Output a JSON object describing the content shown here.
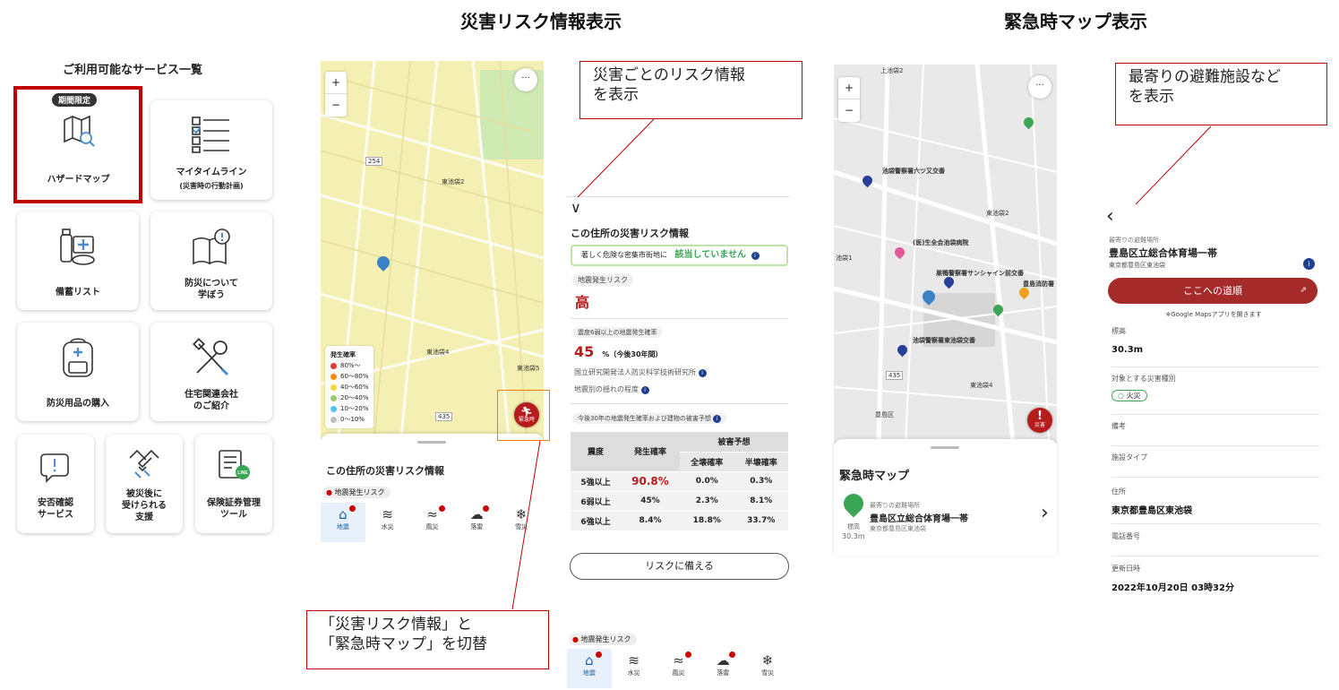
{
  "titles": {
    "left": "災害リスク情報表示",
    "right": "緊急時マップ表示"
  },
  "service_list": {
    "heading": "ご利用可能なサービス一覧",
    "badge": "期間限定",
    "items": [
      {
        "label": "ハザードマップ",
        "icon": "map-search-icon"
      },
      {
        "label": "マイタイムライン",
        "sub": "(災害時の行動計画)",
        "icon": "checklist-icon"
      },
      {
        "label": "備蓄リスト",
        "icon": "supplies-icon"
      },
      {
        "label": "防災について\n学ぼう",
        "icon": "book-alert-icon"
      },
      {
        "label": "防災用品の購入",
        "icon": "backpack-icon"
      },
      {
        "label": "住宅関連会社\nのご紹介",
        "icon": "tools-icon"
      },
      {
        "label": "安否確認\nサービス",
        "icon": "message-alert-icon"
      },
      {
        "label": "被災後に\n受けられる\n支援",
        "icon": "handshake-icon"
      },
      {
        "label": "保険証券管理\nツール",
        "icon": "document-line-icon"
      }
    ]
  },
  "hazard_map": {
    "zoom_in": "+",
    "zoom_out": "−",
    "more": "···",
    "labels": {
      "higashi_ikebukuro2": "東池袋2",
      "higashi_ikebukuro4": "東池袋4",
      "higashi_ikebukuro5": "東池袋5",
      "road_254": "254",
      "road_435": "435"
    },
    "legend": {
      "title": "発生確率",
      "items": [
        {
          "label": "80%〜",
          "color": "#e53935"
        },
        {
          "label": "60〜80%",
          "color": "#fb8c00"
        },
        {
          "label": "40〜60%",
          "color": "#fdd835"
        },
        {
          "label": "20〜40%",
          "color": "#9ccc65"
        },
        {
          "label": "10〜20%",
          "color": "#4fc3f7"
        },
        {
          "label": "0〜10%",
          "color": "#bdbdbd"
        }
      ]
    },
    "emergency_button": "緊急時",
    "sheet_title": "この住所の災害リスク情報",
    "risk_chip": "地震発生リスク"
  },
  "tabs": [
    {
      "label": "地震",
      "icon": "house-earthquake-icon",
      "alert": true
    },
    {
      "label": "水災",
      "icon": "water-wave-icon",
      "alert": false
    },
    {
      "label": "風災",
      "icon": "wind-icon",
      "alert": true
    },
    {
      "label": "落雷",
      "icon": "cloud-lightning-icon",
      "alert": true
    },
    {
      "label": "雪災",
      "icon": "snowflake-icon",
      "alert": false
    }
  ],
  "risk_detail": {
    "collapse": "∨",
    "title": "この住所の災害リスク情報",
    "dense_area_label": "著しく危険な密集市街地に",
    "dense_area_value": "該当していません",
    "eq_risk_chip": "地震発生リスク",
    "eq_risk_value": "高",
    "prob_chip": "震度6弱以上の地震発生確率",
    "prob_value": "45",
    "prob_unit": "%（今後30年間）",
    "source": "国立研究開発法人防災科学技術研究所",
    "shake_link": "地震別の揺れの程度",
    "forecast_chip": "今後30年の地震発生確率および建物の被害予想",
    "table": {
      "h_intensity": "震度",
      "h_prob": "発生確率",
      "h_damage": "被害予想",
      "h_full": "全壊確率",
      "h_half": "半壊確率",
      "rows": [
        {
          "intensity": "5強以上",
          "prob": "90.8%",
          "full": "0.0%",
          "half": "0.3%"
        },
        {
          "intensity": "6弱以上",
          "prob": "45%",
          "full": "2.3%",
          "half": "8.1%"
        },
        {
          "intensity": "6強以上",
          "prob": "8.4%",
          "full": "18.8%",
          "half": "33.7%"
        }
      ]
    },
    "prepare_button": "リスクに備える",
    "bottom_chip": "地震発生リスク"
  },
  "notes": {
    "risk_info": "災害ごとのリスク情報\nを表示",
    "switch": "「災害リスク情報」と\n「緊急時マップ」を切替",
    "nearest": "最寄りの避難施設など\nを表示"
  },
  "emergency_map": {
    "zoom_in": "+",
    "zoom_out": "−",
    "more": "···",
    "labels": {
      "kami_ikebukuro2": "上池袋2",
      "police_rokutsu": "池袋警察署六ツ又交番",
      "higashi_ikebukuro2": "東池袋2",
      "hospital": "(医)生全会池袋病院",
      "sunshine": "巣鴨警察署サンシャイン前交番",
      "toshima_fire": "豊島消防署",
      "ikebukuro1": "池袋1",
      "higashi_police": "池袋警察署東池袋交番",
      "higashi_ikebukuro4": "東池袋4",
      "toshima_ku": "豊島区",
      "road_435": "435"
    },
    "disaster_button": "災害",
    "sheet_title": "緊急時マップ",
    "shelter_kind": "最寄りの避難場所",
    "shelter_name": "豊島区立総合体育場一帯",
    "shelter_address": "東京都豊島区東池袋",
    "elevation_label": "標高",
    "elevation_value": "30.3m",
    "chevron": "›"
  },
  "facility_detail": {
    "back": "‹",
    "kind": "最寄りの避難場所",
    "name": "豊島区立総合体育場一帯",
    "address": "東京都豊島区東池袋",
    "route_button": "ここへの道順",
    "route_note": "※Google Mapsアプリを開きます",
    "elevation_label": "標高",
    "elevation_value": "30.3m",
    "disaster_type_label": "対象とする災害種別",
    "disaster_type_value": "火災",
    "remarks_label": "備考",
    "facility_type_label": "施設タイプ",
    "address_label": "住所",
    "address_value": "東京都豊島区東池袋",
    "phone_label": "電話番号",
    "updated_label": "更新日時",
    "updated_value": "2022年10月20日 03時32分"
  },
  "colors": {
    "accent_red": "#a52a2a",
    "annotation_red": "#c00000",
    "hazard_yellow": "#f5f0b0",
    "green": "#3aa655"
  }
}
